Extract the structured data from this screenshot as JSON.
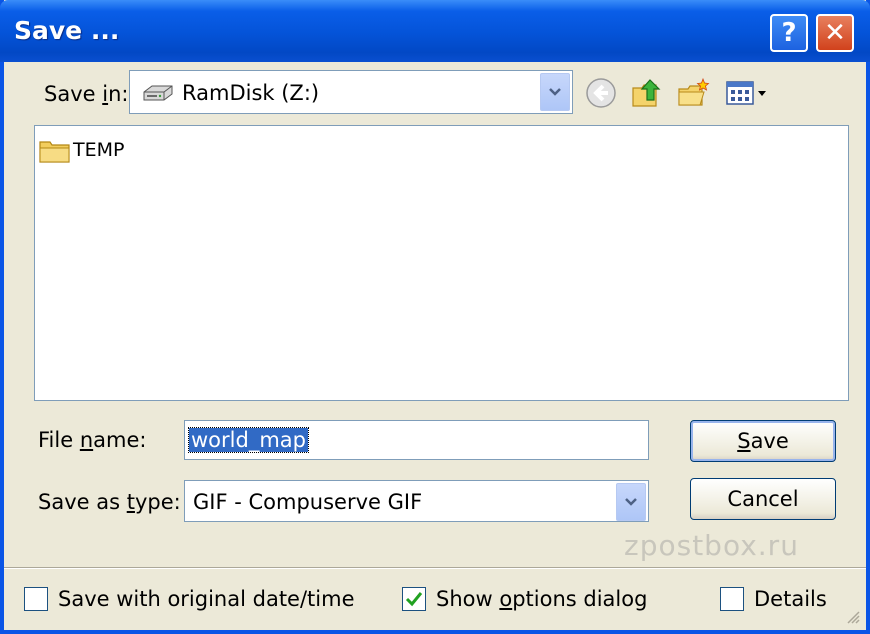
{
  "window": {
    "title": "Save ..."
  },
  "titlebar": {
    "help_glyph": "?",
    "close_glyph": "✕"
  },
  "toolbar": {
    "save_in_prefix": "Save ",
    "save_in_hotkey": "i",
    "save_in_suffix": "n:",
    "location": "RamDisk (Z:)",
    "location_icon": "drive-icon",
    "back_icon": "back-arrow-icon",
    "up_icon": "up-folder-icon",
    "new_folder_icon": "new-folder-icon",
    "view_menu_icon": "view-menu-icon"
  },
  "files": [
    {
      "name": "TEMP",
      "icon": "folder-icon"
    }
  ],
  "form": {
    "filename_prefix": "File ",
    "filename_hotkey": "n",
    "filename_suffix": "ame:",
    "filename_value": "world_map",
    "type_prefix": "Save as ",
    "type_hotkey": "t",
    "type_suffix": "ype:",
    "type_value": "GIF - Compuserve GIF"
  },
  "buttons": {
    "save_hotkey": "S",
    "save_rest": "ave",
    "cancel": "Cancel"
  },
  "options": {
    "keep_date": {
      "label": "Save with original date/time",
      "checked": false
    },
    "show_options_pre": "Show ",
    "show_options_hotkey": "o",
    "show_options_post": "ptions dialog",
    "show_options_checked": true,
    "details": {
      "label": "Details",
      "checked": false
    }
  },
  "watermark": "zpostbox.ru",
  "colors": {
    "titlebar": "#0453d8",
    "dialog_bg": "#ece9d8",
    "selection": "#316ac5",
    "check": "#21a121"
  }
}
